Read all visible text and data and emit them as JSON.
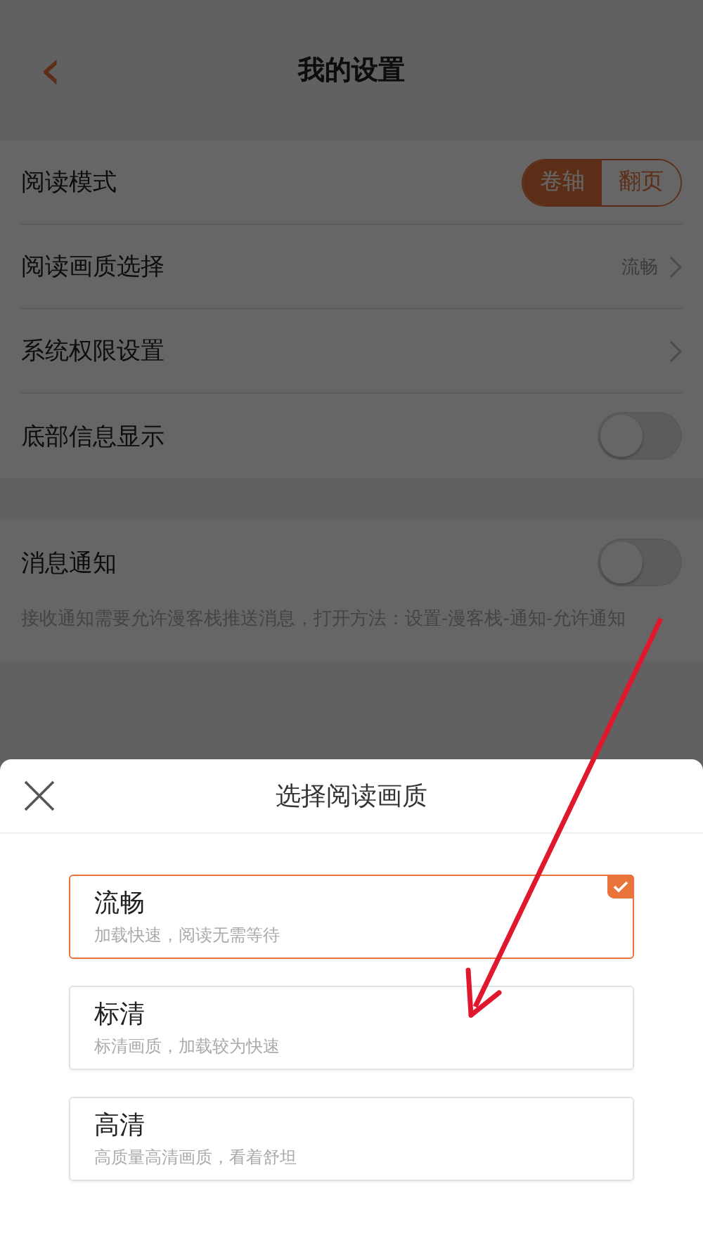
{
  "header": {
    "back_icon": "‹",
    "title": "我的设置"
  },
  "settings_groups": [
    {
      "rows": [
        {
          "kind": "segmented",
          "label": "阅读模式",
          "options": [
            {
              "label": "卷轴",
              "selected": true
            },
            {
              "label": "翻页",
              "selected": false
            }
          ]
        },
        {
          "kind": "link",
          "label": "阅读画质选择",
          "value": "流畅"
        },
        {
          "kind": "link",
          "label": "系统权限设置"
        },
        {
          "kind": "toggle",
          "label": "底部信息显示",
          "on": false
        }
      ]
    },
    {
      "rows": [
        {
          "kind": "toggle",
          "label": "消息通知",
          "on": false
        }
      ],
      "note": "接收通知需要允许漫客栈推送消息，打开方法：设置-漫客栈-通知-允许通知"
    }
  ],
  "sheet": {
    "title": "选择阅读画质",
    "options": [
      {
        "name": "流畅",
        "description": "加载快速，阅读无需等待",
        "selected": true
      },
      {
        "name": "标清",
        "description": "标清画质，加载较为快速",
        "selected": false
      },
      {
        "name": "高清",
        "description": "高质量高清画质，看着舒坦",
        "selected": false
      }
    ]
  }
}
